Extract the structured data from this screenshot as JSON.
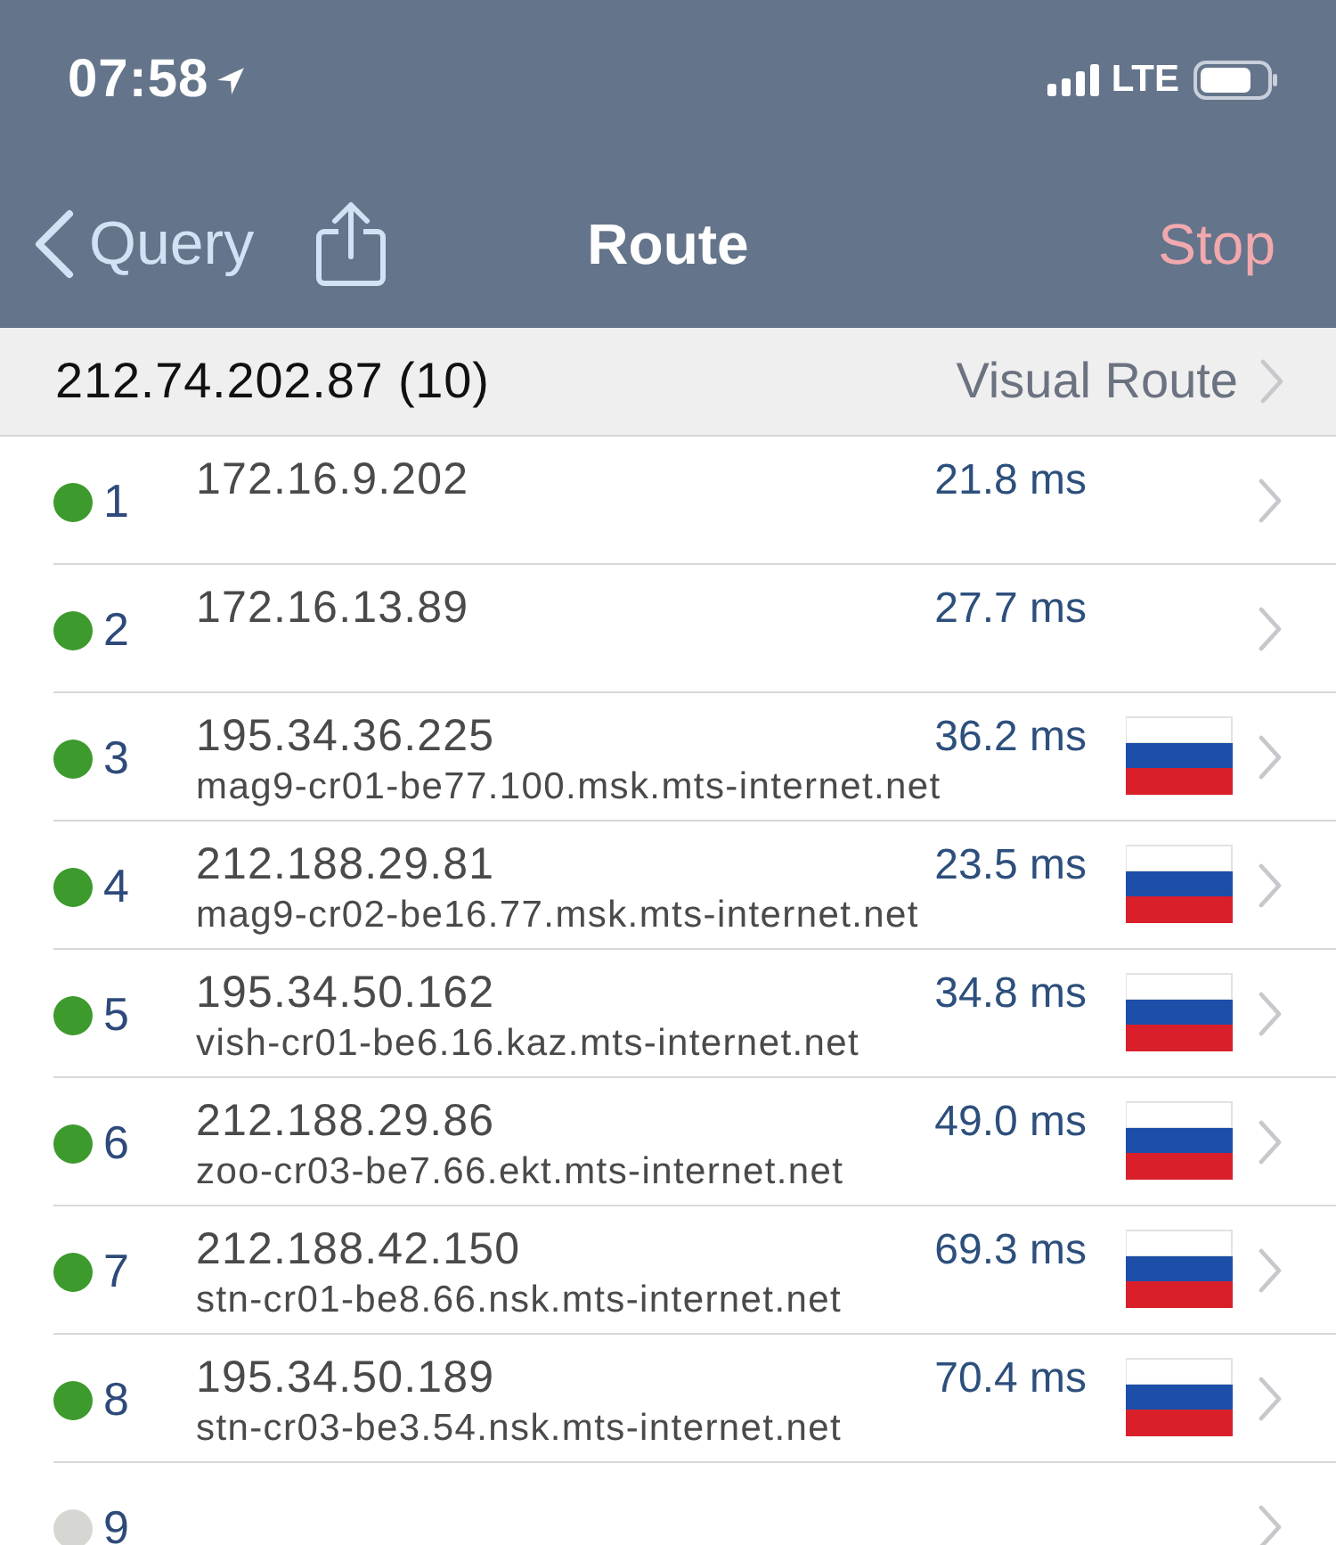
{
  "status_bar": {
    "time": "07:58",
    "network": "LTE"
  },
  "nav_bar": {
    "back": "Query",
    "title": "Route",
    "action": "Stop"
  },
  "summary": {
    "target": "212.74.202.87 (10)",
    "link": "Visual Route"
  },
  "hops": [
    {
      "number": "1",
      "color": "#3d9a2c",
      "ip": "172.16.9.202",
      "latency": "21.8 ms",
      "flag": false
    },
    {
      "number": "2",
      "color": "#3d9a2c",
      "ip": "172.16.13.89",
      "latency": "27.7 ms",
      "flag": false
    },
    {
      "number": "3",
      "color": "#3d9a2c",
      "ip": "195.34.36.225",
      "latency": "36.2 ms",
      "host": "mag9-cr01-be77.100.msk.mts-internet.net",
      "flag": true
    },
    {
      "number": "4",
      "color": "#3d9a2c",
      "ip": "212.188.29.81",
      "latency": "23.5 ms",
      "host": "mag9-cr02-be16.77.msk.mts-internet.net",
      "flag": true
    },
    {
      "number": "5",
      "color": "#3d9a2c",
      "ip": "195.34.50.162",
      "latency": "34.8 ms",
      "host": "vish-cr01-be6.16.kaz.mts-internet.net",
      "flag": true
    },
    {
      "number": "6",
      "color": "#3d9a2c",
      "ip": "212.188.29.86",
      "latency": "49.0 ms",
      "host": "zoo-cr03-be7.66.ekt.mts-internet.net",
      "flag": true
    },
    {
      "number": "7",
      "color": "#3d9a2c",
      "ip": "212.188.42.150",
      "latency": "69.3 ms",
      "host": "stn-cr01-be8.66.nsk.mts-internet.net",
      "flag": true
    },
    {
      "number": "8",
      "color": "#3d9a2c",
      "ip": "195.34.50.189",
      "latency": "70.4 ms",
      "host": "stn-cr03-be3.54.nsk.mts-internet.net",
      "flag": true
    },
    {
      "number": "9",
      "color": "#d6d6d2",
      "flag": false
    }
  ]
}
